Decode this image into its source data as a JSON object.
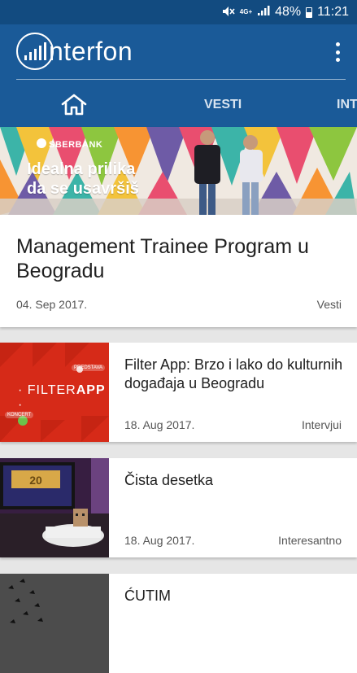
{
  "status_bar": {
    "network": "4G+",
    "battery": "48%",
    "time": "11:21"
  },
  "app": {
    "logo_text": "nterfon"
  },
  "tabs": [
    {
      "id": "home",
      "icon": "home-icon"
    },
    {
      "id": "vesti",
      "label": "VESTI"
    },
    {
      "id": "int",
      "label": "INT"
    }
  ],
  "featured": {
    "banner": {
      "brand": "SBERBANK",
      "headline": "Idealna prilika da se usavršiš"
    },
    "title": "Management Trainee Program u Beogradu",
    "date": "04. Sep 2017.",
    "category": "Vesti"
  },
  "articles": [
    {
      "title": "Filter App: Brzo i lako do kulturnih događaja u Beogradu",
      "date": "18. Aug 2017.",
      "category": "Intervjui",
      "thumb_text_a": "FILTER",
      "thumb_text_b": "APP"
    },
    {
      "title": "Čista desetka",
      "date": "18. Aug 2017.",
      "category": "Interesantno"
    },
    {
      "title": "ĆUTIM",
      "date": "",
      "category": ""
    }
  ],
  "colors": {
    "status_bar": "#124b80",
    "app_bar": "#1a5a98",
    "background": "#e6e6e6",
    "filter_red": "#d62a18"
  }
}
